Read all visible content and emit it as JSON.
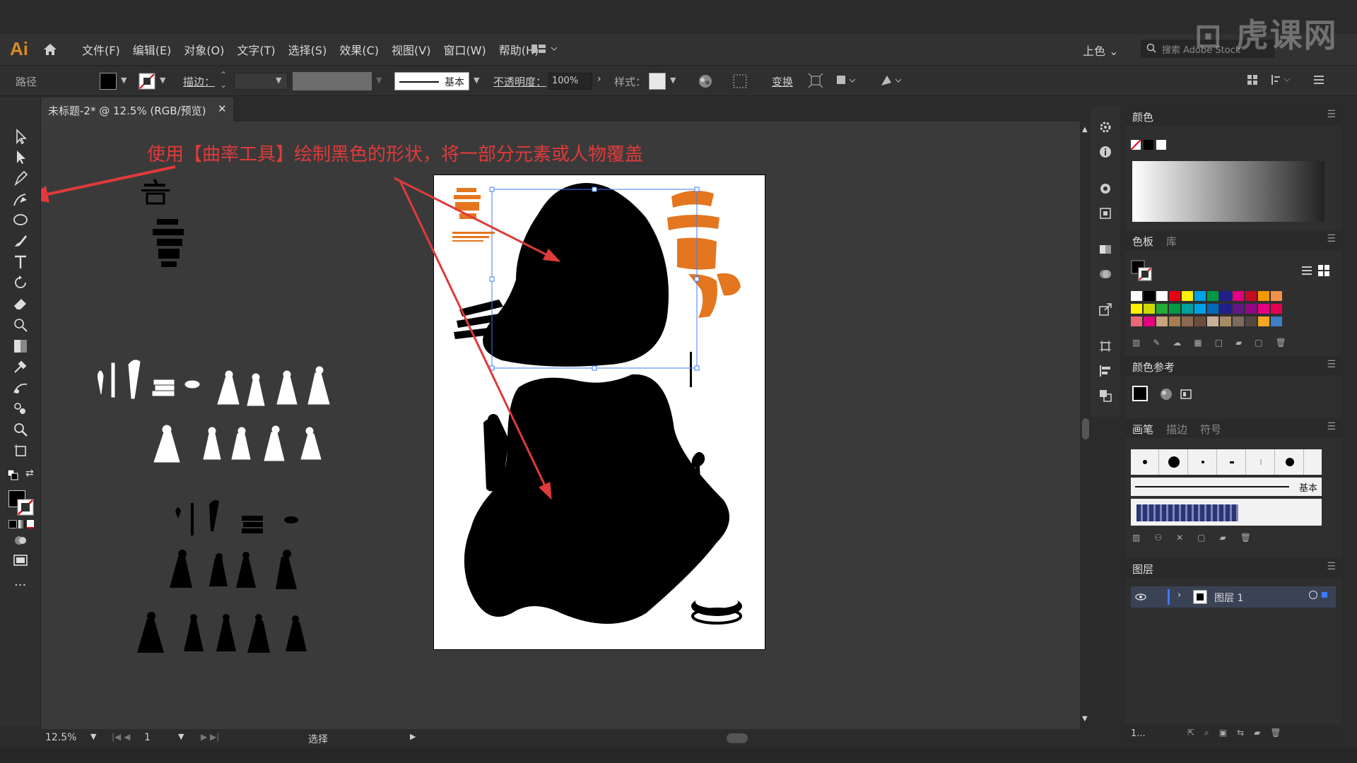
{
  "app": {
    "logo": "Ai",
    "watermark": "虎课网"
  },
  "menu": {
    "items": [
      "文件(F)",
      "编辑(E)",
      "对象(O)",
      "文字(T)",
      "选择(S)",
      "效果(C)",
      "视图(V)",
      "窗口(W)",
      "帮助(H)"
    ],
    "workspace": "上色",
    "search_placeholder": "搜索 Adobe Stock"
  },
  "control": {
    "path_label": "路径",
    "stroke_label": "描边：",
    "brush_label": "基本",
    "opacity_label": "不透明度：",
    "opacity_value": "100%",
    "style_label": "样式：",
    "transform_label": "变换"
  },
  "document": {
    "tab_title": "未标题-2* @ 12.5% (RGB/预览)"
  },
  "annotation": {
    "text": "使用【曲率工具】绘制黑色的形状，将一部分元素或人物覆盖",
    "color": "#e03a3a"
  },
  "panels": {
    "color": "颜色",
    "swatches_tab": "色板",
    "library_tab": "库",
    "color_guide": "颜色参考",
    "brush_tab": "画笔",
    "stroke_tab": "描边",
    "symbol_tab": "符号",
    "brush_basic": "基本",
    "layers": "图层",
    "layer_name": "图层 1",
    "layer_count": "1..."
  },
  "status": {
    "zoom": "12.5%",
    "artboard": "1",
    "mode": "选择"
  },
  "colors": {
    "accent": "#d98a28",
    "orange_art": "#e4761f"
  },
  "swatch_rows": [
    [
      "#ffffff",
      "#000000",
      "#ffffff",
      "#e60012",
      "#fff100",
      "#00a0e9",
      "#009944",
      "#1d2088",
      "#e4007f",
      "#c30d23",
      "#f39800",
      "#f19149"
    ],
    [
      "#fff100",
      "#cfdb00",
      "#22ac38",
      "#009944",
      "#00a29a",
      "#00a0e9",
      "#0068b7",
      "#1d2088",
      "#601986",
      "#920783",
      "#e4007f",
      "#e5004f"
    ],
    [
      "#eb6877",
      "#e4007f",
      "#c9a27e",
      "#a67c52",
      "#8b6a4f",
      "#6b4c3b",
      "#c7b299",
      "#a68b64",
      "#7d6b5d",
      "#534741",
      "#f5a623",
      "#3c7fc4"
    ]
  ]
}
